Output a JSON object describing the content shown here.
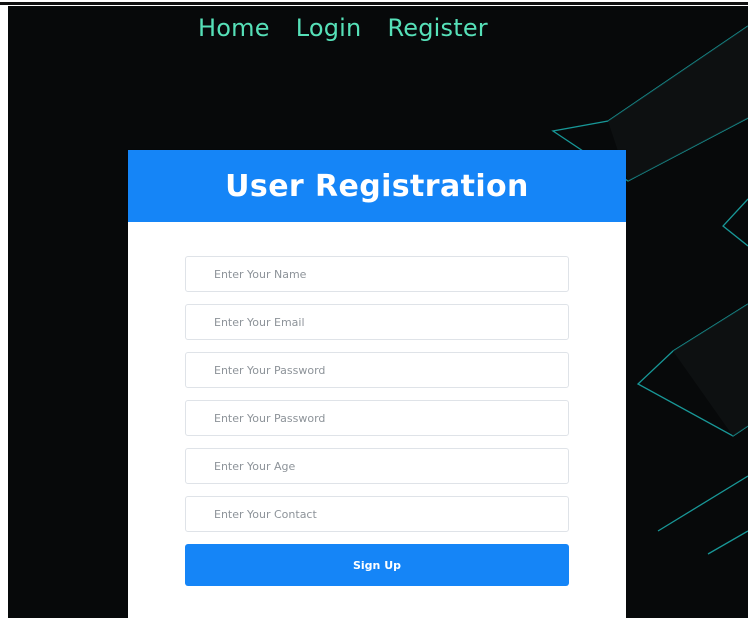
{
  "nav": {
    "items": [
      {
        "label": "Home"
      },
      {
        "label": "Login"
      },
      {
        "label": "Register"
      }
    ]
  },
  "form": {
    "title": "User Registration",
    "fields": [
      {
        "placeholder": "Enter Your Name"
      },
      {
        "placeholder": "Enter Your Email"
      },
      {
        "placeholder": "Enter Your Password"
      },
      {
        "placeholder": "Enter Your Password"
      },
      {
        "placeholder": "Enter Your Age"
      },
      {
        "placeholder": "Enter Your Contact"
      }
    ],
    "submit_label": "Sign Up"
  },
  "colors": {
    "page_background": "#07090a",
    "nav_text": "#56e0b8",
    "card_header": "#1585f7",
    "button": "#1585f7",
    "decorative_lines": "#1ec7c7"
  }
}
